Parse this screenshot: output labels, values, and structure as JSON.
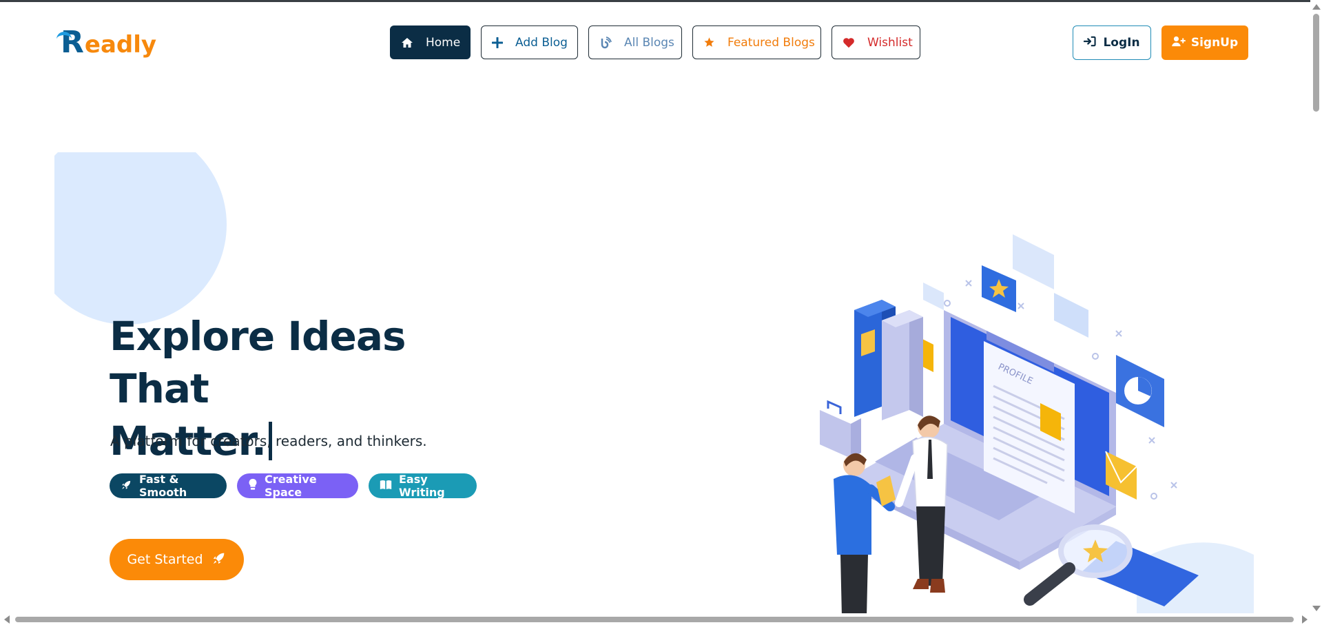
{
  "brand": {
    "logo_initial": "R",
    "logo_rest": "eadly"
  },
  "nav": {
    "items": [
      {
        "label": "Home",
        "icon": "home-icon"
      },
      {
        "label": "Add Blog",
        "icon": "plus-icon"
      },
      {
        "label": "All Blogs",
        "icon": "blog-icon"
      },
      {
        "label": "Featured Blogs",
        "icon": "star-icon"
      },
      {
        "label": "Wishlist",
        "icon": "heart-icon"
      }
    ]
  },
  "auth": {
    "login_label": "LogIn",
    "signup_label": "SignUp"
  },
  "hero": {
    "title_line1": "Explore Ideas That",
    "title_line2": "Matter.",
    "subtitle": "A platform for creators, readers, and thinkers.",
    "badges": [
      {
        "label": "Fast & Smooth",
        "icon": "rocket-icon"
      },
      {
        "label": "Creative Space",
        "icon": "lightbulb-icon"
      },
      {
        "label": "Easy Writing",
        "icon": "book-icon"
      }
    ],
    "cta_label": "Get Started",
    "illustration_text": "PROFILE"
  },
  "colors": {
    "navy": "#0b2d45",
    "orange": "#fb8a08",
    "blue": "#0b5e93",
    "purple": "#7b61f5",
    "teal": "#1b9bb5",
    "red": "#d42a2a"
  }
}
